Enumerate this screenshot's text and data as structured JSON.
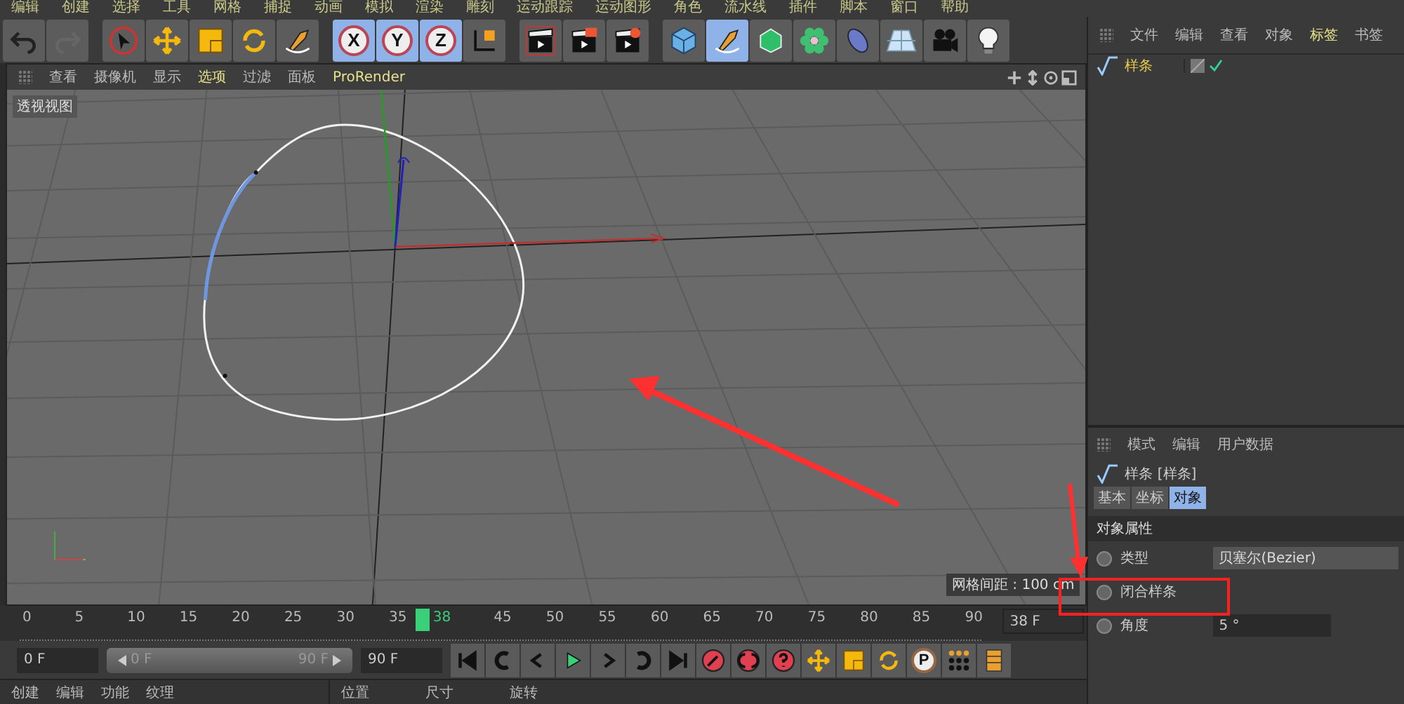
{
  "menu_bar": [
    "编辑",
    "创建",
    "选择",
    "工具",
    "网格",
    "捕捉",
    "动画",
    "模拟",
    "渲染",
    "雕刻",
    "运动跟踪",
    "运动图形",
    "角色",
    "流水线",
    "插件",
    "脚本",
    "窗口",
    "帮助"
  ],
  "toolbar": {
    "groups": [
      [
        {
          "kind": "undo",
          "selected": false
        },
        {
          "kind": "redo",
          "selected": false
        }
      ],
      [
        {
          "kind": "select",
          "selected": false
        },
        {
          "kind": "move",
          "selected": false
        },
        {
          "kind": "scale",
          "selected": false
        },
        {
          "kind": "rotate",
          "selected": false
        },
        {
          "kind": "pen",
          "selected": false
        }
      ],
      [
        {
          "kind": "axis",
          "label": "X",
          "selected": true
        },
        {
          "kind": "axis",
          "label": "Y",
          "selected": true
        },
        {
          "kind": "axis",
          "label": "Z",
          "selected": true
        },
        {
          "kind": "coord",
          "selected": false
        }
      ],
      [
        {
          "kind": "render-view",
          "selected": false
        },
        {
          "kind": "render",
          "selected": false
        },
        {
          "kind": "render-settings",
          "selected": false
        }
      ],
      [
        {
          "kind": "cube",
          "selected": false
        },
        {
          "kind": "spline-pen",
          "selected": true
        },
        {
          "kind": "polygon",
          "selected": false
        },
        {
          "kind": "cloner",
          "selected": false
        },
        {
          "kind": "deformer",
          "selected": false
        },
        {
          "kind": "floor",
          "selected": false
        },
        {
          "kind": "camera",
          "selected": false
        },
        {
          "kind": "light",
          "selected": false
        }
      ]
    ]
  },
  "viewport": {
    "menu": [
      {
        "label": "查看",
        "highlighted": false
      },
      {
        "label": "摄像机",
        "highlighted": false
      },
      {
        "label": "显示",
        "highlighted": false
      },
      {
        "label": "选项",
        "highlighted": true
      },
      {
        "label": "过滤",
        "highlighted": false
      },
      {
        "label": "面板",
        "highlighted": false
      },
      {
        "label": "ProRender",
        "highlighted": true
      }
    ],
    "view_label": "透视视图",
    "grid_spacing": "网格间距 : 100 cm"
  },
  "timeline": {
    "ticks_before_playhead": [
      "0",
      "5",
      "10",
      "15",
      "20",
      "25",
      "30",
      "35"
    ],
    "ticks_after_playhead": [
      "45",
      "50",
      "55",
      "60",
      "65",
      "70",
      "75",
      "80",
      "85",
      "90"
    ],
    "playhead": {
      "label": "38",
      "level": 0.4222
    },
    "current_frame": "38 F"
  },
  "controls": {
    "start": "0 F",
    "range_start": "0 F",
    "range_end": "90 F",
    "end": "90 F",
    "buttons": [
      {
        "kind": "first"
      },
      {
        "kind": "prev-key"
      },
      {
        "kind": "prev-frame"
      },
      {
        "kind": "play"
      },
      {
        "kind": "next-frame"
      },
      {
        "kind": "next-key"
      },
      {
        "kind": "last"
      },
      {
        "kind": "record"
      },
      {
        "kind": "autokey"
      },
      {
        "kind": "keyhelp"
      },
      {
        "kind": "key-move"
      },
      {
        "kind": "key-scale"
      },
      {
        "kind": "key-rotate"
      },
      {
        "kind": "key-param",
        "label": "P"
      },
      {
        "kind": "key-points"
      },
      {
        "kind": "film"
      }
    ]
  },
  "bottom": {
    "left_tabs": [
      "创建",
      "编辑",
      "功能",
      "纹理"
    ],
    "right_tabs": [
      "位置",
      "尺寸",
      "旋转"
    ]
  },
  "object_manager": {
    "menu": [
      {
        "label": "文件",
        "highlighted": false
      },
      {
        "label": "编辑",
        "highlighted": false
      },
      {
        "label": "查看",
        "highlighted": false
      },
      {
        "label": "对象",
        "highlighted": false
      },
      {
        "label": "标签",
        "highlighted": true
      },
      {
        "label": "书签",
        "highlighted": false
      }
    ],
    "objects": [
      {
        "name": "样条",
        "selected": true,
        "enabled": true
      }
    ]
  },
  "attributes": {
    "menu": [
      "模式",
      "编辑",
      "用户数据"
    ],
    "title": "样条 [样条]",
    "tabs": [
      {
        "label": "基本",
        "selected": false
      },
      {
        "label": "坐标",
        "selected": false
      },
      {
        "label": "对象",
        "selected": true
      }
    ],
    "section": "对象属性",
    "fields": [
      {
        "kind": "dropdown",
        "label": "类型",
        "value": "贝塞尔(Bezier)"
      },
      {
        "kind": "text",
        "label": "闭合样条"
      },
      {
        "kind": "number",
        "label": "角度",
        "value": "5 °"
      }
    ]
  }
}
